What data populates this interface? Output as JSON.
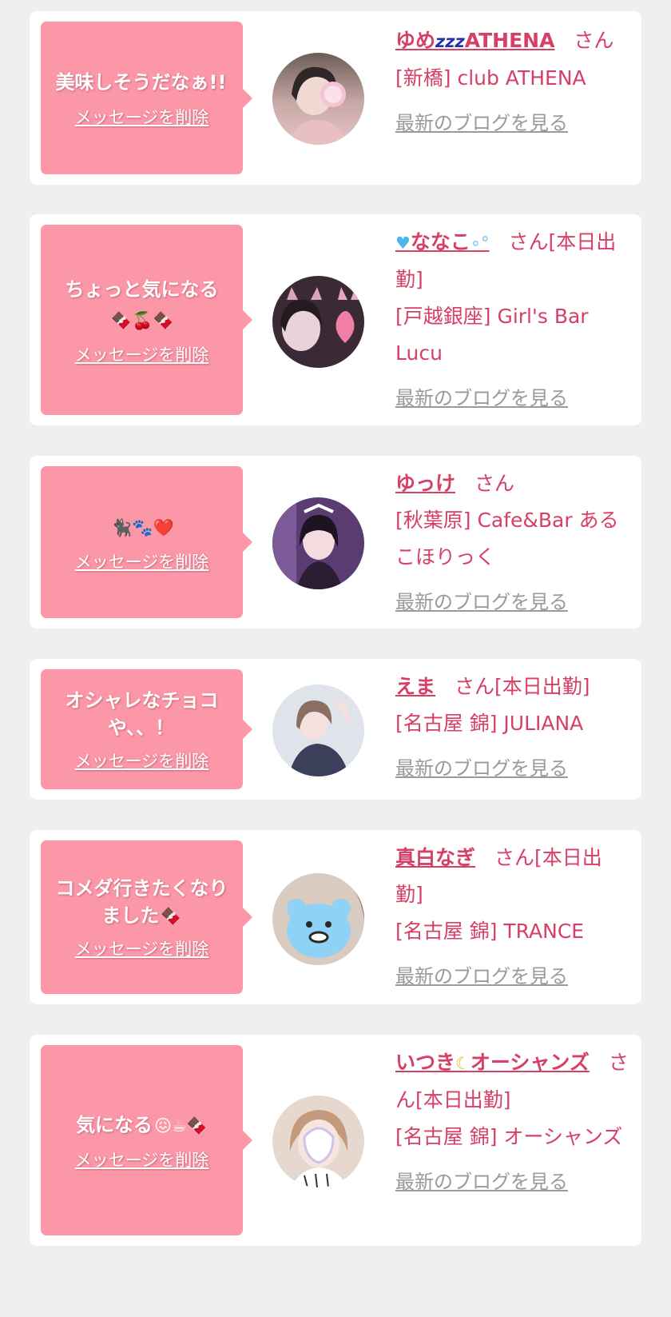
{
  "delete_label": "メッセージを削除",
  "blog_label": "最新のブログを見る",
  "cards": [
    {
      "message": "美味しそうだなぁ!!",
      "message_emoji": "",
      "name": "ゆめ",
      "name_suffix": "ATHENA",
      "name_icon": "zzz-icon",
      "honorific": "さん",
      "status": "",
      "shop": "[新橋] club ATHENA"
    },
    {
      "message": "ちょっと気になる",
      "message_emoji": "🍫🍒🍫",
      "name": "ななこ",
      "name_suffix": "",
      "name_icon": "blue-heart-icon",
      "honorific": "さん",
      "status": "[本日出勤]",
      "shop": "[戸越銀座] Girl's Bar Lucu"
    },
    {
      "message": "",
      "message_emoji": "🐈‍⬛🐾❤️",
      "name": "ゆっけ",
      "name_suffix": "",
      "name_icon": "",
      "honorific": "さん",
      "status": "",
      "shop": "[秋葉原] Cafe&Bar あるこほりっく"
    },
    {
      "message": "オシャレなチョコや、、！",
      "message_emoji": "",
      "name": "えま",
      "name_suffix": "",
      "name_icon": "",
      "honorific": "さん",
      "status": "[本日出勤]",
      "shop": "[名古屋 錦] JULIANA"
    },
    {
      "message": "コメダ行きたくなりました",
      "message_emoji": "🍫",
      "name": "真白なぎ",
      "name_suffix": "",
      "name_icon": "",
      "honorific": "さん",
      "status": "[本日出勤]",
      "shop": "[名古屋 錦] TRANCE"
    },
    {
      "message": "気になる",
      "message_emoji": "😖☕🍫",
      "name": "いつき",
      "name_suffix": "オーシャンズ",
      "name_icon": "moon-icon",
      "honorific": "さん",
      "status": "[本日出勤]",
      "shop": "[名古屋 錦] オーシャンズ"
    }
  ]
}
